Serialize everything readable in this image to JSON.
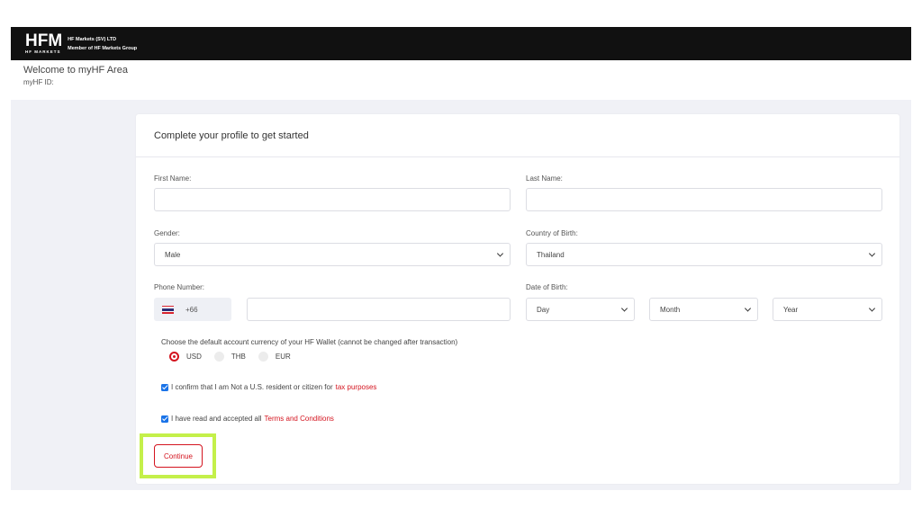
{
  "header": {
    "logo_text_main": "HFM",
    "logo_text_sub": "HF MARKETS",
    "company_line1": "HF Markets (SV) LTD",
    "company_line2": "Member of HF Markets Group"
  },
  "welcome": {
    "title": "Welcome to myHF Area",
    "id_label": "myHF ID:"
  },
  "form": {
    "title": "Complete your profile to get started",
    "first_name_label": "First Name:",
    "first_name_value": "",
    "last_name_label": "Last Name:",
    "last_name_value": "",
    "gender_label": "Gender:",
    "gender_value": "Male",
    "country_label": "Country of Birth:",
    "country_value": "Thailand",
    "phone_label": "Phone Number:",
    "phone_prefix": "+66",
    "phone_value": "",
    "dob_label": "Date of Birth:",
    "dob_day": "Day",
    "dob_month": "Month",
    "dob_year": "Year",
    "currency_label": "Choose the default account currency of your HF Wallet (cannot be changed after transaction)",
    "currencies": [
      {
        "label": "USD",
        "selected": true
      },
      {
        "label": "THB",
        "selected": false
      },
      {
        "label": "EUR",
        "selected": false
      }
    ],
    "confirm_text": "I confirm that I am Not a U.S. resident or citizen for",
    "confirm_link": "tax purposes",
    "terms_text": "I have read and accepted all",
    "terms_link": "Terms and Conditions",
    "continue_label": "Continue"
  },
  "colors": {
    "accent": "#d4141f",
    "highlight": "#c4f04a",
    "topbar": "#111111",
    "checkbox": "#1a73e8"
  },
  "icons": {
    "phone_flag": "thailand-flag-icon",
    "select_arrow": "chevron-down-icon"
  }
}
